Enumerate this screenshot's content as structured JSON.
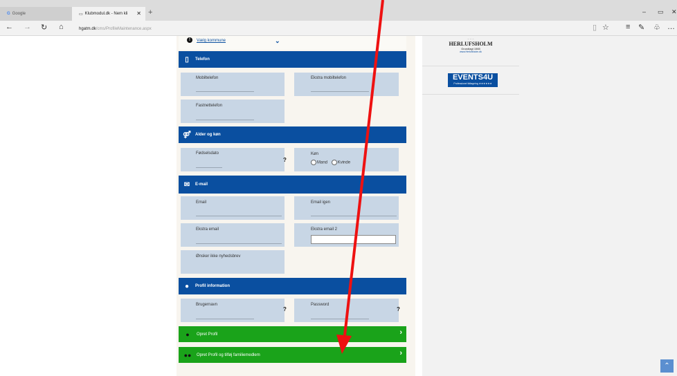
{
  "browser": {
    "tabs": [
      {
        "label": "Google"
      },
      {
        "label": "Klubmodul.dk - Nem kli"
      }
    ],
    "url_host": "hgatm.dk",
    "url_path": "/cms/ProfileMaintenance.aspx"
  },
  "form": {
    "kommune": {
      "label": "Vælg kommune"
    },
    "telefon": {
      "header": "Telefon",
      "mobil": "Mobiltelefon",
      "ekstra_mobil": "Ekstra mobiltelefon",
      "fastnet": "Fastnettelefon"
    },
    "alder": {
      "header": "Alder og køn",
      "dato": "Fødselsdato",
      "kon": "Køn",
      "mand": "Mand",
      "kvinde": "Kvinde"
    },
    "email": {
      "header": "E-mail",
      "email": "Email",
      "email_igen": "Email igen",
      "ekstra": "Ekstra email",
      "ekstra2": "Ekstra email 2",
      "nyhedsbrev": "Ønsker ikke nyhedsbrev"
    },
    "profil": {
      "header": "Profil information",
      "brugernavn": "Brugernavn",
      "password": "Password"
    },
    "actions": {
      "opret": "Opret Profil",
      "opret_familie": "Opret Profil og tilføj familiemedlem"
    }
  },
  "sidebar": {
    "herlufsholm": {
      "line1": "HERLUFSHOLM",
      "line2": "Grundlagt 1565",
      "line3": "www.Herlufsholm.dk"
    },
    "events": {
      "line1": "EVENTS4U",
      "line2": "Professionel tidtagning ★★★★★★"
    }
  },
  "colors": {
    "header_blue": "#0a4fa0",
    "action_green": "#1aa31a",
    "field_bg": "#c8d6e5",
    "arrow_red": "#ee1111"
  }
}
